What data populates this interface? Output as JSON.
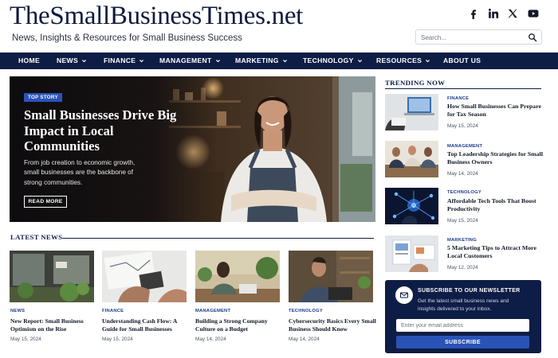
{
  "header": {
    "site_title": "TheSmallBusinessTimes.net",
    "tagline": "News, Insights & Resources for Small Business Success",
    "social": [
      "facebook-icon",
      "linkedin-icon",
      "x-icon",
      "youtube-icon"
    ],
    "search_placeholder": "Search..."
  },
  "nav": {
    "items": [
      {
        "label": "HOME",
        "has_dropdown": false
      },
      {
        "label": "NEWS",
        "has_dropdown": true
      },
      {
        "label": "FINANCE",
        "has_dropdown": true
      },
      {
        "label": "MANAGEMENT",
        "has_dropdown": true
      },
      {
        "label": "MARKETING",
        "has_dropdown": true
      },
      {
        "label": "TECHNOLOGY",
        "has_dropdown": true
      },
      {
        "label": "RESOURCES",
        "has_dropdown": true
      },
      {
        "label": "ABOUT US",
        "has_dropdown": false
      }
    ]
  },
  "hero": {
    "badge": "TOP STORY",
    "title": "Small Businesses Drive Big Impact in Local Communities",
    "description": "From job creation to economic growth, small businesses are the backbone of strong communities.",
    "button": "READ MORE"
  },
  "latest": {
    "heading": "LATEST NEWS",
    "cards": [
      {
        "category": "NEWS",
        "title": "New Report: Small Business Optimism on the Rise",
        "date": "May 15, 2024"
      },
      {
        "category": "FINANCE",
        "title": "Understanding Cash Flow: A Guide for Small Businesses",
        "date": "May 15, 2024"
      },
      {
        "category": "MANAGEMENT",
        "title": "Building a Strong Company Culture on a Budget",
        "date": "May 14, 2024"
      },
      {
        "category": "TECHNOLOGY",
        "title": "Cybersecurity Basics Every Small Business Should Know",
        "date": "May 14, 2024"
      }
    ]
  },
  "trending": {
    "heading": "TRENDING NOW",
    "items": [
      {
        "category": "FINANCE",
        "title": "How Small Businesses Can Prepare for Tax Season",
        "date": "May 15, 2024"
      },
      {
        "category": "MANAGEMENT",
        "title": "Top Leadership Strategies for Small Business Owners",
        "date": "May 14, 2024"
      },
      {
        "category": "TECHNOLOGY",
        "title": "Affordable Tech Tools That Boost Productivity",
        "date": "May 15, 2024"
      },
      {
        "category": "MARKETING",
        "title": "5 Marketing Tips to Attract More Local Customers",
        "date": "May 12, 2024"
      }
    ]
  },
  "newsletter": {
    "title": "SUBSCRIBE TO OUR NEWSLETTER",
    "description": "Get the latest small business news and insights delivered to your inbox.",
    "input_placeholder": "Enter your email address",
    "button": "SUBSCRIBE"
  },
  "colors": {
    "brand_navy": "#0e1d45",
    "accent_blue": "#2a53b8",
    "category_blue": "#1d3a8a"
  }
}
